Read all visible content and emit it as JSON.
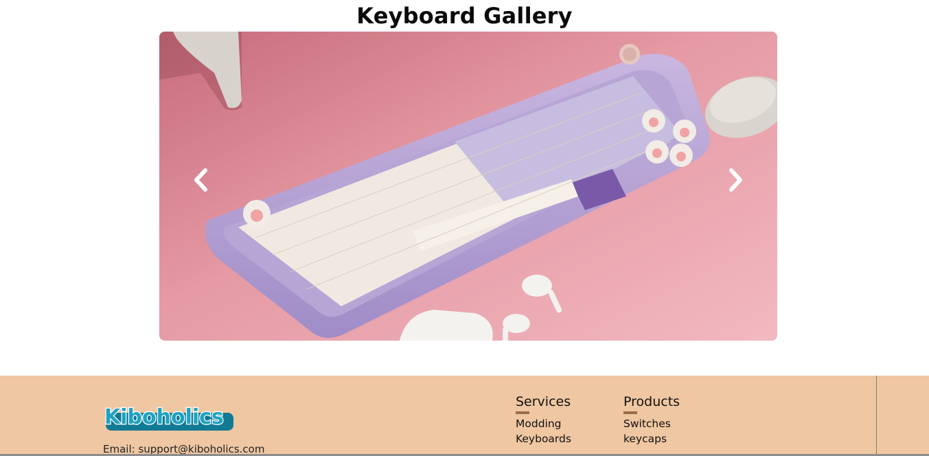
{
  "gallery": {
    "title": "Keyboard Gallery",
    "prev_icon": "chevron-left-icon",
    "next_icon": "chevron-right-icon"
  },
  "footer": {
    "logo_text": "Kiboholics",
    "email": "Email: support@kiboholics.com",
    "services": {
      "heading": "Services",
      "links": [
        "Modding",
        "Keyboards"
      ]
    },
    "products": {
      "heading": "Products",
      "links": [
        "Switches",
        "keycaps"
      ]
    }
  },
  "colors": {
    "footer_bg": "#efc7a2",
    "accent_underline": "#9c6c46",
    "logo_blue": "#1a8fa8"
  }
}
